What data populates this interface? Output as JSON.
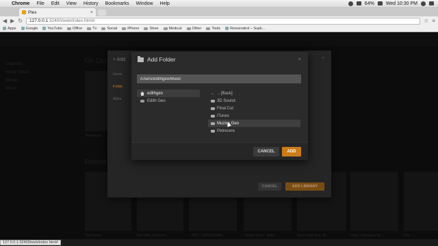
{
  "menubar": {
    "apple": "",
    "items": [
      "Chrome",
      "File",
      "Edit",
      "View",
      "History",
      "Bookmarks",
      "Window",
      "Help"
    ],
    "battery": "64%",
    "clock": "Wed 10:30 PM"
  },
  "browser": {
    "tab_title": "Plex",
    "tab_close": "×",
    "url_host": "127.0.0.1",
    "url_path": ":32400/web/index.html#",
    "bookmarks": [
      "Apps",
      "Google",
      "YouTube",
      "Office",
      "Tv",
      "Social",
      "iPhone",
      "Store",
      "Medical",
      "Other",
      "Tools",
      "Resveratrol – Supli..."
    ]
  },
  "plex_bg": {
    "deck_title": "On Deck",
    "recent_title": "Recent",
    "sidebar": [
      "Channels",
      "Home Videos",
      "Movies",
      "Music"
    ],
    "thumb_captions": [
      "The Prince",
      "Ben Wife Stories A...",
      "PSY - GENTLEMAN",
      "Maître Gims - Bella",
      "Sinu Hodor feat. M...",
      "India - Dernières Se...",
      "Ella ..."
    ]
  },
  "add_library": {
    "side_items": [
      "+ Add",
      "Gene",
      "Folde",
      "Adva"
    ],
    "cancel_label": "CANCEL",
    "add_label": "ADD LIBRARY",
    "close": "×"
  },
  "add_folder": {
    "title": "Add Folder",
    "close": "×",
    "path_value": "/Users/edithgeo/Music",
    "locations": [
      {
        "label": "edithgeo",
        "selected": true
      },
      {
        "label": "Edith Geo",
        "selected": false
      }
    ],
    "dirs": [
      {
        "label": ".. [Back]"
      },
      {
        "label": "3D Sound"
      },
      {
        "label": "Final Cut"
      },
      {
        "label": "iTunes"
      },
      {
        "label": "Muzica Geo"
      },
      {
        "label": "Petrecere"
      }
    ],
    "cancel_label": "CANCEL",
    "add_label": "ADD"
  },
  "status": {
    "url": "127.0.0.1:32400/web/index.html#"
  },
  "colors": {
    "accent": "#cc7b19",
    "dialog_bg": "#2b2b2b"
  }
}
